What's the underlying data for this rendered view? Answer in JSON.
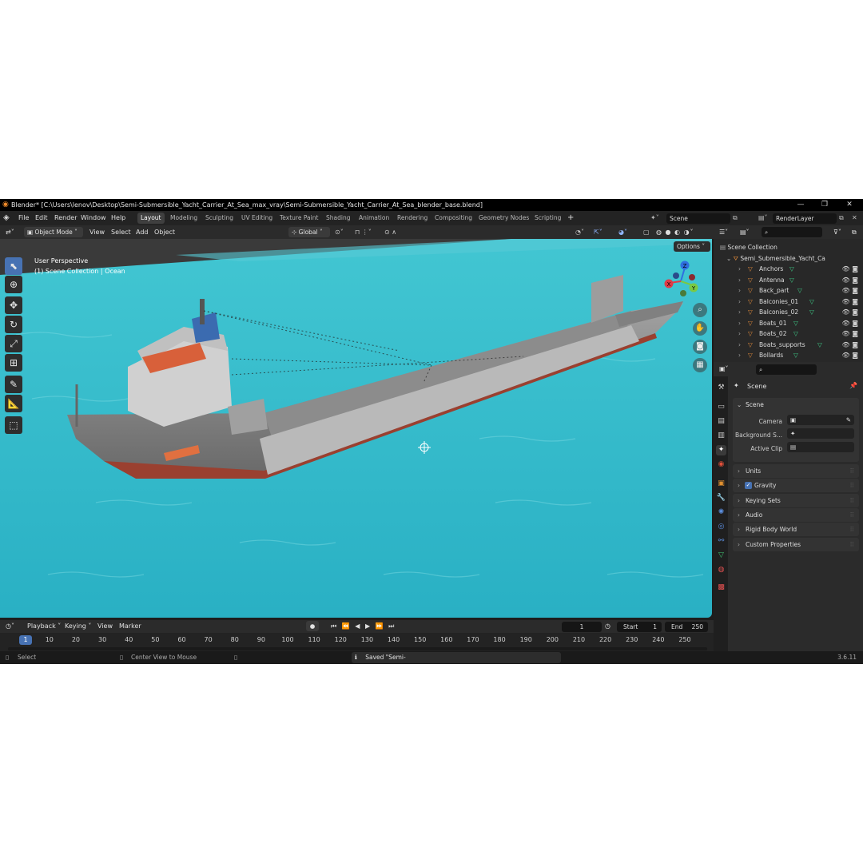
{
  "title_bar": {
    "title": "Blender* [C:\\Users\\lenov\\Desktop\\Semi-Submersible_Yacht_Carrier_At_Sea_max_vray\\Semi-Submersible_Yacht_Carrier_At_Sea_blender_base.blend]",
    "minimize": "—",
    "maximize": "❐",
    "close": "✕"
  },
  "menu": [
    "File",
    "Edit",
    "Render",
    "Window",
    "Help"
  ],
  "workspaces": [
    "Layout",
    "Modeling",
    "Sculpting",
    "UV Editing",
    "Texture Paint",
    "Shading",
    "Animation",
    "Rendering",
    "Compositing",
    "Geometry Nodes",
    "Scripting"
  ],
  "active_workspace": "Layout",
  "add_workspace": "+",
  "scene_field": "Scene",
  "view_layer_field": "RenderLayer",
  "viewport_header": {
    "mode": "Object Mode",
    "view": "View",
    "select": "Select",
    "add": "Add",
    "object": "Object",
    "orientation": "Global"
  },
  "viewport_overlay": {
    "perspective": "User Perspective",
    "collection": "(1) Scene Collection | Ocean",
    "options": "Options"
  },
  "gizmo": {
    "x": "X",
    "y": "Y",
    "z": "Z"
  },
  "outliner": {
    "root": "Scene Collection",
    "collection": "Semi_Submersible_Yacht_Ca",
    "items": [
      "Anchors",
      "Antenna",
      "Back_part",
      "Balconies_01",
      "Balconies_02",
      "Boats_01",
      "Boats_02",
      "Boats_supports",
      "Bollards"
    ]
  },
  "properties": {
    "header": "Scene",
    "panel": "Scene",
    "camera_label": "Camera",
    "background_label": "Background S...",
    "active_clip_label": "Active Clip",
    "sections": [
      "Units",
      "Gravity",
      "Keying Sets",
      "Audio",
      "Rigid Body World",
      "Custom Properties"
    ],
    "gravity_checked": true
  },
  "timeline": {
    "playback": "Playback",
    "keying": "Keying",
    "view": "View",
    "marker": "Marker",
    "current_frame": "1",
    "start_label": "Start",
    "start": "1",
    "end_label": "End",
    "end": "250",
    "frames": [
      "1",
      "10",
      "20",
      "30",
      "40",
      "50",
      "60",
      "70",
      "80",
      "90",
      "100",
      "110",
      "120",
      "130",
      "140",
      "150",
      "160",
      "170",
      "180",
      "190",
      "200",
      "210",
      "220",
      "230",
      "240",
      "250"
    ]
  },
  "status_bar": {
    "select": "Select",
    "center": "Center View to Mouse",
    "saved": "Saved \"Semi-Submersible_Yacht_Carrier_At_Sea_blender_base.blend\"",
    "version": "3.6.11"
  },
  "colors": {
    "accent": "#4772b3",
    "water": "#2bb8c8",
    "hull": "#8a8a8a",
    "lifeboat": "#e07040"
  }
}
